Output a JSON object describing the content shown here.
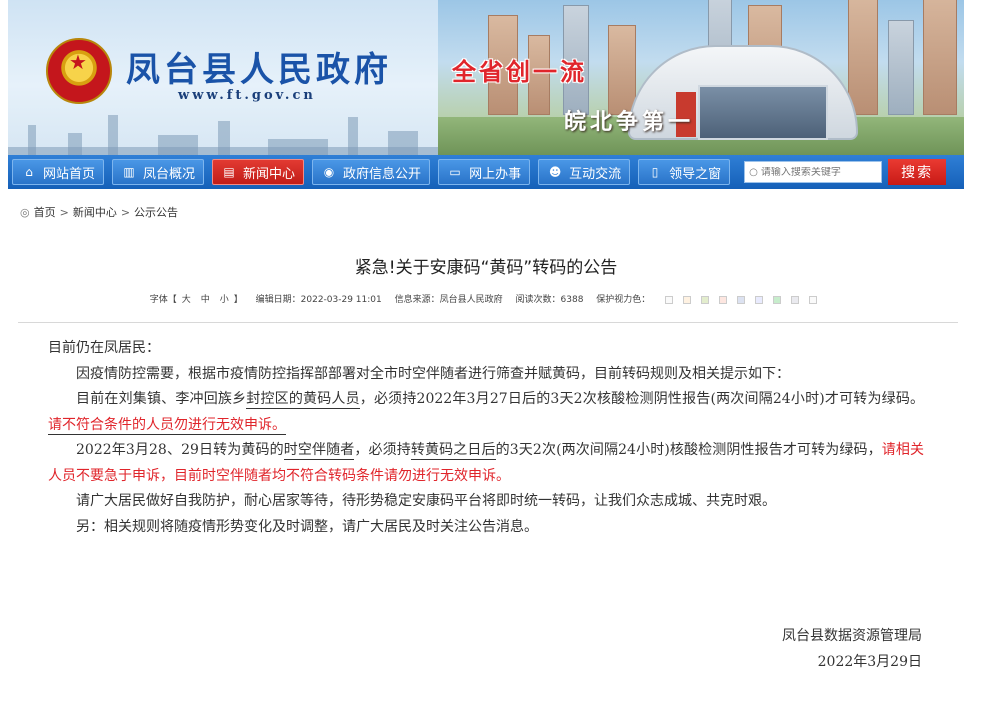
{
  "header": {
    "site_title": "凤台县人民政府",
    "site_url": "www.ft.gov.cn",
    "slogan1": "全省创一流",
    "slogan2": "皖北争第一"
  },
  "nav": {
    "items": [
      {
        "label": "网站首页",
        "icon": "home-icon"
      },
      {
        "label": "凤台概况",
        "icon": "city-icon"
      },
      {
        "label": "新闻中心",
        "icon": "news-icon",
        "active": true
      },
      {
        "label": "政府信息公开",
        "icon": "compass-icon"
      },
      {
        "label": "网上办事",
        "icon": "monitor-icon"
      },
      {
        "label": "互动交流",
        "icon": "people-icon"
      },
      {
        "label": "领导之窗",
        "icon": "document-icon"
      }
    ],
    "search_placeholder": "请输入搜索关键字",
    "search_button": "搜索"
  },
  "breadcrumb": {
    "home": "首页",
    "level1": "新闻中心",
    "level2": "公示公告"
  },
  "article": {
    "title": "紧急!关于安康码“黄码”转码的公告",
    "meta": {
      "font_label": "字体【大　中　小】",
      "font_sizes": [
        "大",
        "中",
        "小"
      ],
      "date": "编辑日期：2022-03-29 11:01",
      "source": "信息来源：凤台县人民政府",
      "views": "阅读次数：6388",
      "eye_care": "保护视力色：",
      "swatch_colors": [
        "#fafafa",
        "#fff2e2",
        "#e3edcd",
        "#fde6e0",
        "#dce2f1",
        "#e9ebfe",
        "#c7edcc",
        "#eaeaef",
        "#fafafa"
      ]
    },
    "p0": "目前仍在凤居民：",
    "p1": "因疫情防控需要，根据市疫情防控指挥部部署对全市时空伴随者进行筛查并赋黄码，目前转码规则及相关提示如下：",
    "p2_a": "目前在刘集镇、李冲回族乡",
    "p2_b": "封控区的黄码人员",
    "p2_c": "，必须持",
    "p2_d": "2022年3月27日后的3天2次核酸检测阴性报告(两次间隔24小时)才可转为绿码。",
    "p2_red": "请不符合条件的人员勿进行无效申诉。",
    "p3_a": "2022年3月28、29日转为黄码的",
    "p3_b": "时空伴随者",
    "p3_c": "，必须持",
    "p3_d": "转黄码之日后",
    "p3_e": "的3天2次(两次间隔24小时)核酸检测阴性报告才可转为绿码，",
    "p3_red": "请相关人员不要急于申诉，目前时空伴随者均不符合转码条件请勿进行无效申诉。",
    "p4": "请广大居民做好自我防护，耐心居家等待，待形势稳定安康码平台将即时统一转码，让我们众志成城、共克时艰。",
    "p5": "另：相关规则将随疫情形势变化及时调整，请广大居民及时关注公告消息。",
    "signer": "凤台县数据资源管理局",
    "sign_date": "2022年3月29日"
  }
}
